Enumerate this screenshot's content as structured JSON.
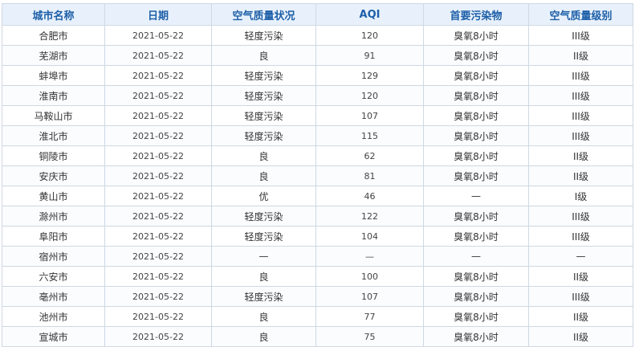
{
  "table": {
    "headers": [
      "城市名称",
      "日期",
      "空气质量状况",
      "AQI",
      "首要污染物",
      "空气质量级别"
    ],
    "rows": [
      [
        "合肥市",
        "2021-05-22",
        "轻度污染",
        "120",
        "臭氧8小时",
        "III级"
      ],
      [
        "芜湖市",
        "2021-05-22",
        "良",
        "91",
        "臭氧8小时",
        "II级"
      ],
      [
        "蚌埠市",
        "2021-05-22",
        "轻度污染",
        "129",
        "臭氧8小时",
        "III级"
      ],
      [
        "淮南市",
        "2021-05-22",
        "轻度污染",
        "120",
        "臭氧8小时",
        "III级"
      ],
      [
        "马鞍山市",
        "2021-05-22",
        "轻度污染",
        "107",
        "臭氧8小时",
        "III级"
      ],
      [
        "淮北市",
        "2021-05-22",
        "轻度污染",
        "115",
        "臭氧8小时",
        "III级"
      ],
      [
        "铜陵市",
        "2021-05-22",
        "良",
        "62",
        "臭氧8小时",
        "II级"
      ],
      [
        "安庆市",
        "2021-05-22",
        "良",
        "81",
        "臭氧8小时",
        "II级"
      ],
      [
        "黄山市",
        "2021-05-22",
        "优",
        "46",
        "—",
        "I级"
      ],
      [
        "滁州市",
        "2021-05-22",
        "轻度污染",
        "122",
        "臭氧8小时",
        "III级"
      ],
      [
        "阜阳市",
        "2021-05-22",
        "轻度污染",
        "104",
        "臭氧8小时",
        "III级"
      ],
      [
        "宿州市",
        "2021-05-22",
        "—",
        "—",
        "—",
        "—"
      ],
      [
        "六安市",
        "2021-05-22",
        "良",
        "100",
        "臭氧8小时",
        "II级"
      ],
      [
        "亳州市",
        "2021-05-22",
        "轻度污染",
        "107",
        "臭氧8小时",
        "III级"
      ],
      [
        "池州市",
        "2021-05-22",
        "良",
        "77",
        "臭氧8小时",
        "II级"
      ],
      [
        "宣城市",
        "2021-05-22",
        "良",
        "75",
        "臭氧8小时",
        "II级"
      ]
    ]
  }
}
